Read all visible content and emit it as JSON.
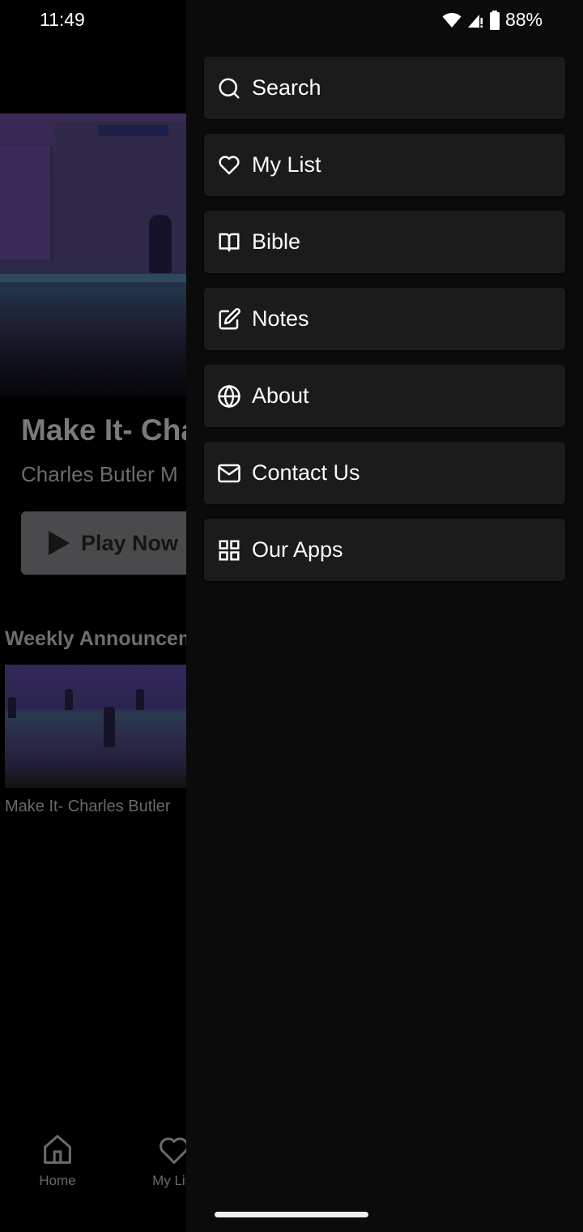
{
  "status_bar": {
    "time": "11:49",
    "battery_percent": "88%",
    "icons": [
      "wifi-icon",
      "cell-signal-alert-icon",
      "battery-icon"
    ]
  },
  "background_screen": {
    "hero": {
      "title": "Make It- Charles Butler",
      "subtitle": "Charles Butler M",
      "play_button_label": "Play Now"
    },
    "section_title": "Weekly Announcements",
    "items": [
      {
        "caption": "Make It- Charles Butler"
      }
    ],
    "bottom_nav": [
      {
        "label": "Home",
        "icon": "home-icon"
      },
      {
        "label": "My List",
        "icon": "heart-icon"
      }
    ]
  },
  "drawer": {
    "menu": [
      {
        "label": "Search",
        "icon": "search-icon"
      },
      {
        "label": "My List",
        "icon": "heart-icon"
      },
      {
        "label": "Bible",
        "icon": "book-icon"
      },
      {
        "label": "Notes",
        "icon": "edit-note-icon"
      },
      {
        "label": "About",
        "icon": "globe-icon"
      },
      {
        "label": "Contact Us",
        "icon": "mail-icon"
      },
      {
        "label": "Our Apps",
        "icon": "apps-grid-icon"
      }
    ]
  },
  "colors": {
    "drawer_bg": "#0b0b0b",
    "menu_item_bg": "#1b1b1b",
    "text": "#fafafa"
  }
}
